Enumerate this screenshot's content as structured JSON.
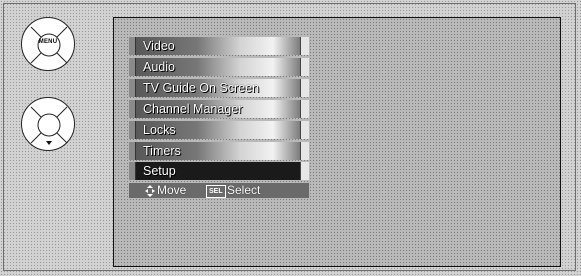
{
  "remote": {
    "menu_button_label": "MENU"
  },
  "menu": {
    "items": [
      {
        "label": "Video"
      },
      {
        "label": "Audio"
      },
      {
        "label": "TV Guide On Screen"
      },
      {
        "label": "Channel Manager"
      },
      {
        "label": "Locks"
      },
      {
        "label": "Timers"
      },
      {
        "label": "Setup"
      }
    ],
    "selected_label": "Setup"
  },
  "footer": {
    "move_icon": "four-way-arrow-icon",
    "move_label": "Move",
    "sel_badge": "SEL",
    "select_label": "Select"
  },
  "colors": {
    "selected_row": "#1a1a1a",
    "screen_background": "#b9b9b9"
  }
}
